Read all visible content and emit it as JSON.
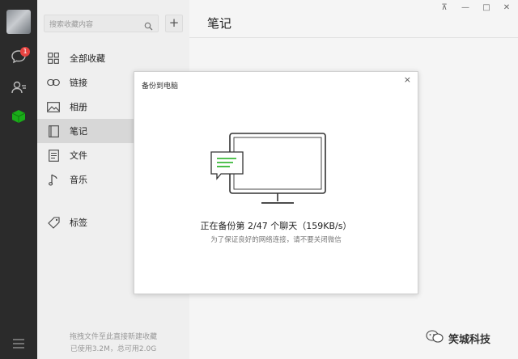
{
  "window": {
    "controls": [
      "⊼",
      "—",
      "□",
      "✕"
    ]
  },
  "rail": {
    "chat_badge": "1",
    "icons": [
      "chat-icon",
      "contacts-icon",
      "favorites-cube-icon",
      "menu-icon"
    ],
    "accent": "#1aad19"
  },
  "sidebar": {
    "search_placeholder": "搜索收藏内容",
    "add_label": "+",
    "items": [
      {
        "label": "全部收藏",
        "icon": "grid-icon"
      },
      {
        "label": "链接",
        "icon": "link-icon"
      },
      {
        "label": "相册",
        "icon": "image-icon"
      },
      {
        "label": "笔记",
        "icon": "note-icon",
        "active": true
      },
      {
        "label": "文件",
        "icon": "file-icon"
      },
      {
        "label": "音乐",
        "icon": "music-icon"
      },
      {
        "label": "标签",
        "icon": "tag-icon"
      }
    ],
    "footer_hint": "拖拽文件至此直接新建收藏",
    "footer_usage": "已使用3.2M，总可用2.0G"
  },
  "main": {
    "title": "笔记"
  },
  "dialog": {
    "title": "备份到电脑",
    "close": "×",
    "status": "正在备份第 2/47 个聊天（159KB/s）",
    "hint": "为了保证良好的网络连接，请不要关闭微信",
    "accent": "#1aad19"
  },
  "watermark": {
    "text": "笑城科技"
  }
}
